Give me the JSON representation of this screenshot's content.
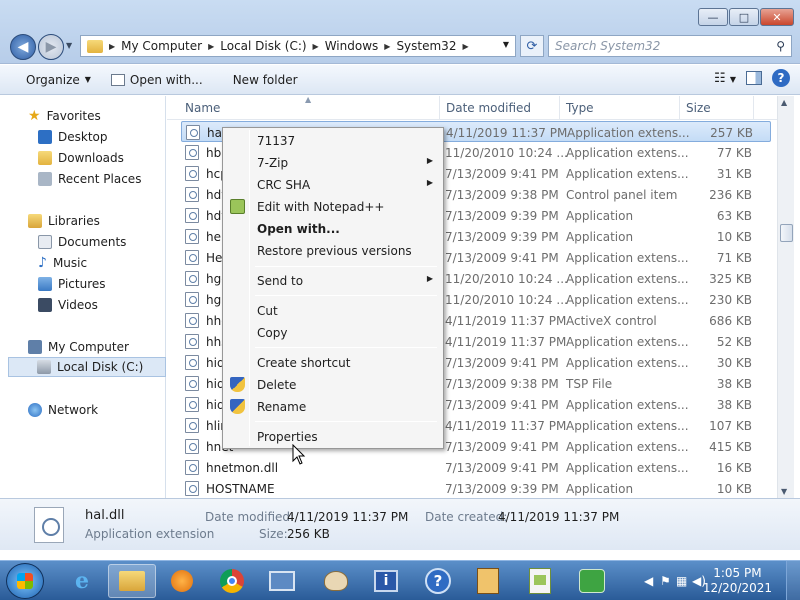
{
  "window": {
    "controls": {
      "minimize": "—",
      "maximize": "□",
      "close": "✕"
    }
  },
  "address": {
    "crumbs": [
      "My Computer",
      "Local Disk (C:)",
      "Windows",
      "System32"
    ],
    "search_placeholder": "Search System32"
  },
  "toolbar": {
    "organize": "Organize",
    "open_with": "Open with...",
    "new_folder": "New folder"
  },
  "navpane": {
    "favorites": "Favorites",
    "desktop": "Desktop",
    "downloads": "Downloads",
    "recent_places": "Recent Places",
    "libraries": "Libraries",
    "documents": "Documents",
    "music": "Music",
    "pictures": "Pictures",
    "videos": "Videos",
    "my_computer": "My Computer",
    "local_disk": "Local Disk (C:)",
    "network": "Network"
  },
  "columns": {
    "name": "Name",
    "date": "Date modified",
    "type": "Type",
    "size": "Size"
  },
  "files": [
    {
      "name": "hal",
      "date": "4/11/2019 11:37 PM",
      "type": "Application extens...",
      "size": "257 KB"
    },
    {
      "name": "hba",
      "date": "11/20/2010 10:24 ...",
      "type": "Application extens...",
      "size": "77 KB"
    },
    {
      "name": "hcp",
      "date": "7/13/2009 9:41 PM",
      "type": "Application extens...",
      "size": "31 KB"
    },
    {
      "name": "hdv",
      "date": "7/13/2009 9:38 PM",
      "type": "Control panel item",
      "size": "236 KB"
    },
    {
      "name": "hdv",
      "date": "7/13/2009 9:39 PM",
      "type": "Application",
      "size": "63 KB"
    },
    {
      "name": "hel",
      "date": "7/13/2009 9:39 PM",
      "type": "Application",
      "size": "10 KB"
    },
    {
      "name": "He",
      "date": "7/13/2009 9:41 PM",
      "type": "Application extens...",
      "size": "71 KB"
    },
    {
      "name": "hgc",
      "date": "11/20/2010 10:24 ...",
      "type": "Application extens...",
      "size": "325 KB"
    },
    {
      "name": "hgp",
      "date": "11/20/2010 10:24 ...",
      "type": "Application extens...",
      "size": "230 KB"
    },
    {
      "name": "hhc",
      "date": "4/11/2019 11:37 PM",
      "type": "ActiveX control",
      "size": "686 KB"
    },
    {
      "name": "hhs",
      "date": "4/11/2019 11:37 PM",
      "type": "Application extens...",
      "size": "52 KB"
    },
    {
      "name": "hid",
      "date": "7/13/2009 9:41 PM",
      "type": "Application extens...",
      "size": "30 KB"
    },
    {
      "name": "hid",
      "date": "7/13/2009 9:38 PM",
      "type": "TSP File",
      "size": "38 KB"
    },
    {
      "name": "hid",
      "date": "7/13/2009 9:41 PM",
      "type": "Application extens...",
      "size": "38 KB"
    },
    {
      "name": "hlin",
      "date": "4/11/2019 11:37 PM",
      "type": "Application extens...",
      "size": "107 KB"
    },
    {
      "name": "hnet",
      "date": "7/13/2009 9:41 PM",
      "type": "Application extens...",
      "size": "415 KB"
    },
    {
      "name": "hnetmon.dll",
      "date": "7/13/2009 9:41 PM",
      "type": "Application extens...",
      "size": "16 KB"
    },
    {
      "name": "HOSTNAME",
      "date": "7/13/2009 9:39 PM",
      "type": "Application",
      "size": "10 KB"
    }
  ],
  "context_menu": {
    "hash": "71137",
    "seven_zip": "7-Zip",
    "crc_sha": "CRC SHA",
    "notepad": "Edit with Notepad++",
    "open_with": "Open with...",
    "restore": "Restore previous versions",
    "send_to": "Send to",
    "cut": "Cut",
    "copy": "Copy",
    "create_shortcut": "Create shortcut",
    "delete": "Delete",
    "rename": "Rename",
    "properties": "Properties"
  },
  "details": {
    "file_name": "hal.dll",
    "file_type": "Application extension",
    "date_modified_label": "Date modified:",
    "date_modified": "4/11/2019 11:37 PM",
    "date_created_label": "Date created:",
    "date_created": "4/11/2019 11:37 PM",
    "size_label": "Size:",
    "size": "256 KB"
  },
  "taskbar": {
    "time": "1:05 PM",
    "date": "12/20/2021"
  }
}
